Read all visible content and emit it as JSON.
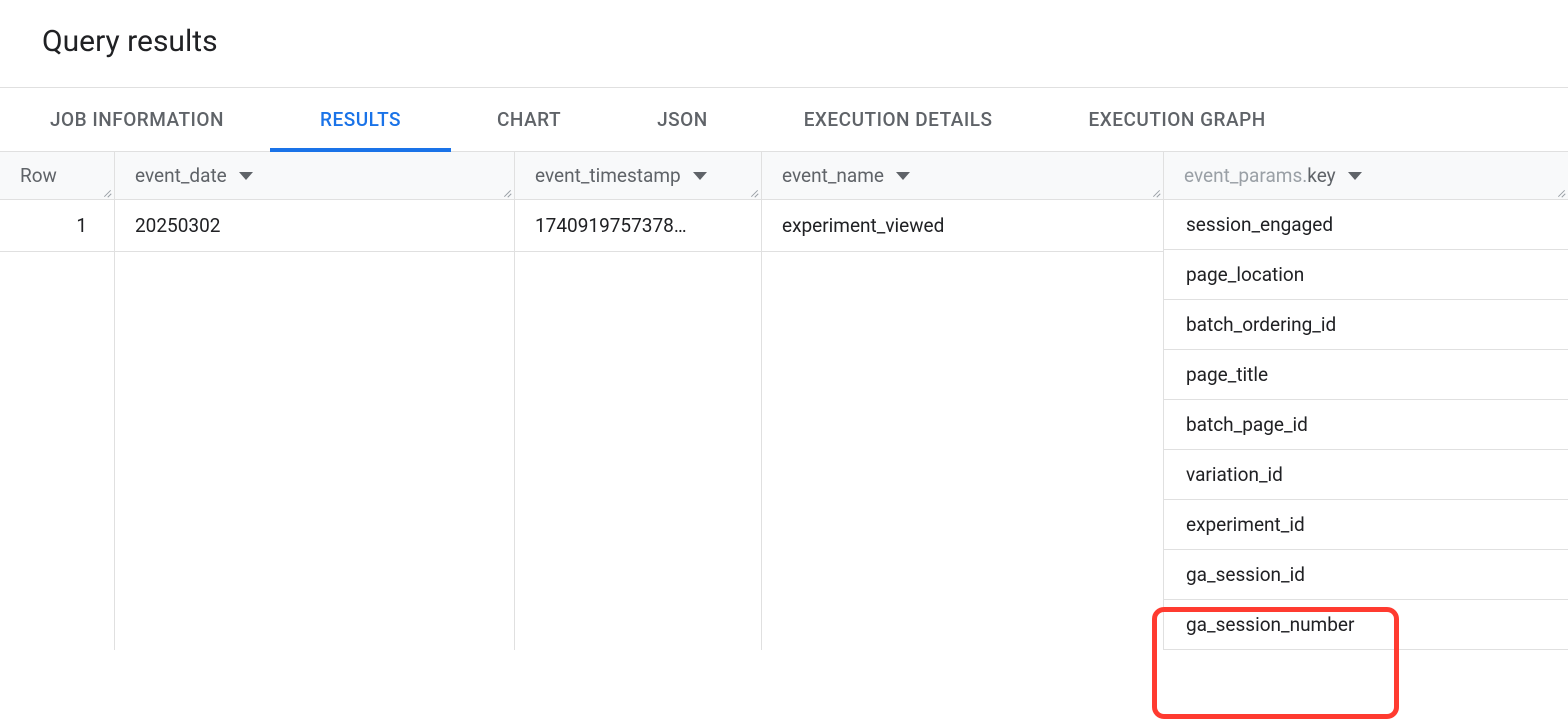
{
  "page": {
    "title": "Query results"
  },
  "tabs": [
    {
      "label": "JOB INFORMATION",
      "active": false
    },
    {
      "label": "RESULTS",
      "active": true
    },
    {
      "label": "CHART",
      "active": false
    },
    {
      "label": "JSON",
      "active": false
    },
    {
      "label": "EXECUTION DETAILS",
      "active": false
    },
    {
      "label": "EXECUTION GRAPH",
      "active": false
    }
  ],
  "table": {
    "headers": {
      "row": "Row",
      "event_date": "event_date",
      "event_timestamp": "event_timestamp",
      "event_name": "event_name",
      "event_params_prefix": "event_params.",
      "event_params_key": "key"
    },
    "rows": [
      {
        "row_num": "1",
        "event_date": "20250302",
        "event_timestamp": "1740919757378…",
        "event_name": "experiment_viewed",
        "event_params": [
          "session_engaged",
          "page_location",
          "batch_ordering_id",
          "page_title",
          "batch_page_id",
          "variation_id",
          "experiment_id",
          "ga_session_id",
          "ga_session_number"
        ]
      }
    ]
  },
  "highlight": {
    "params": [
      "variation_id",
      "experiment_id"
    ]
  }
}
